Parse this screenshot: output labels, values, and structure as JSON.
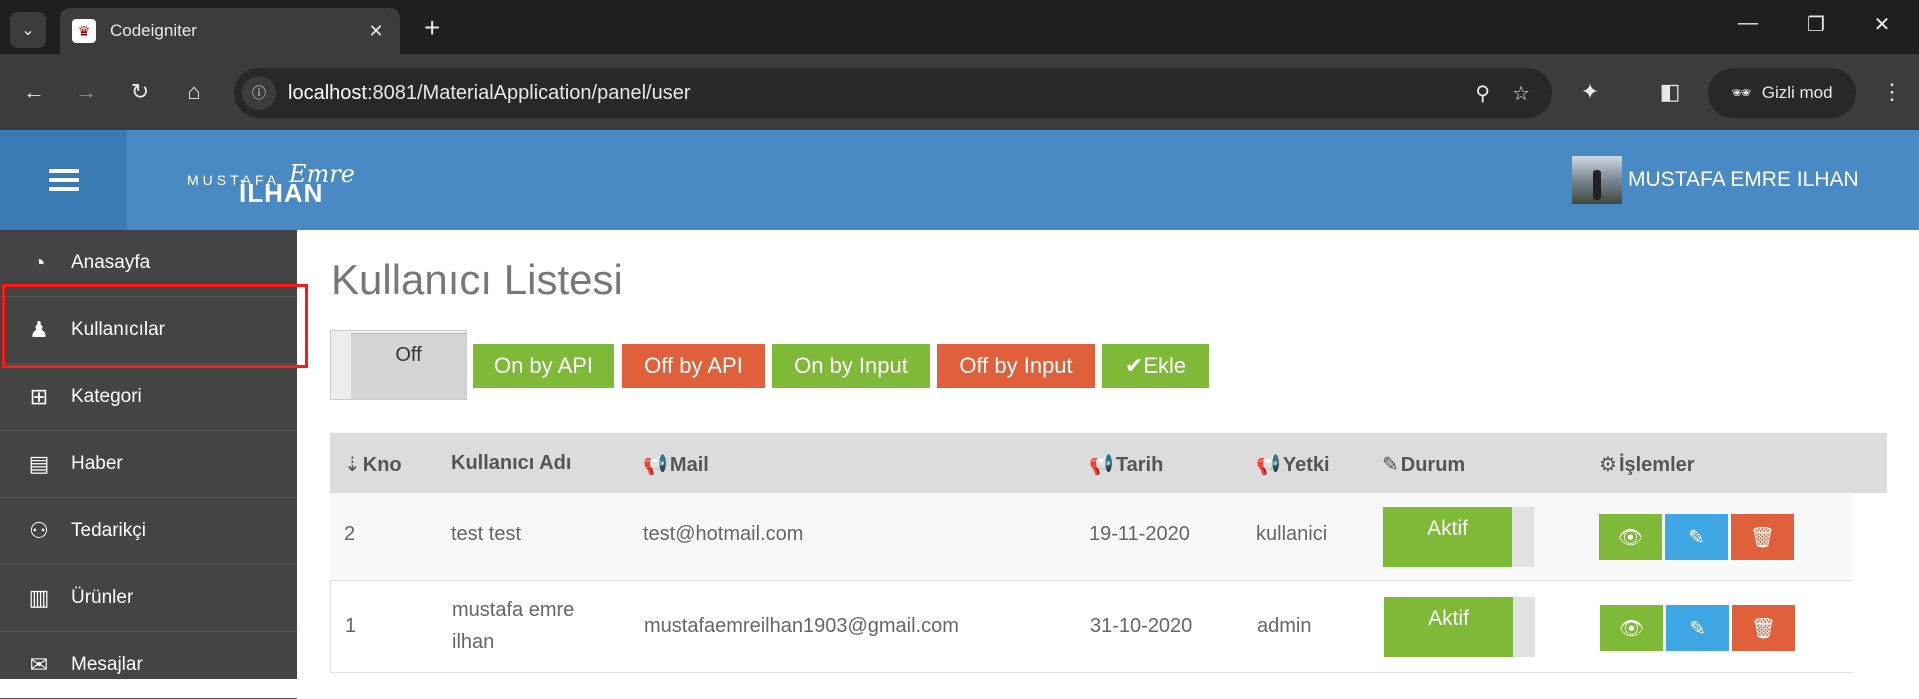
{
  "browser": {
    "tab_title": "Codeigniter",
    "url_host": "localhost",
    "url_rest": ":8081/MaterialApplication/panel/user",
    "incognito_label": "Gizli mod"
  },
  "header": {
    "logo_first": "MUSTAFA",
    "logo_middle": "Emre",
    "logo_last": "İLHAN",
    "user_name": "MUSTAFA EMRE ILHAN",
    "color": "#4a8ac4"
  },
  "sidebar": {
    "items": [
      {
        "label": "Anasayfa",
        "icon": "dashboard-icon"
      },
      {
        "label": "Kullanıcılar",
        "icon": "user-icon"
      },
      {
        "label": "Kategori",
        "icon": "sitemap-icon"
      },
      {
        "label": "Haber",
        "icon": "book-icon"
      },
      {
        "label": "Tedarikçi",
        "icon": "users-icon"
      },
      {
        "label": "Ürünler",
        "icon": "barcode-icon"
      },
      {
        "label": "Mesajlar",
        "icon": "envelope-icon"
      }
    ]
  },
  "main": {
    "title": "Kullanıcı Listesi",
    "toggle_label": "Off",
    "buttons": {
      "on_api": "On by API",
      "off_api": "Off by API",
      "on_input": "On by Input",
      "off_input": "Off by Input",
      "add": "Ekle"
    },
    "table": {
      "headers": {
        "no": "Kno",
        "username": "Kullanıcı Adı",
        "mail": "Mail",
        "date": "Tarih",
        "role": "Yetki",
        "status": "Durum",
        "actions": "İşlemler"
      },
      "rows": [
        {
          "no": "2",
          "username_line1": "test test",
          "username_line2": "",
          "mail": "test@hotmail.com",
          "date": "19-11-2020",
          "role": "kullanici",
          "status": "Aktif"
        },
        {
          "no": "1",
          "username_line1": "mustafa emre",
          "username_line2": "ilhan",
          "mail": "mustafaemreilhan1903@gmail.com",
          "date": "31-10-2020",
          "role": "admin",
          "status": "Aktif"
        }
      ]
    }
  },
  "colors": {
    "green": "#7eb937",
    "red": "#e0603b",
    "blue": "#3ea6e2",
    "sidebar": "#444444"
  }
}
